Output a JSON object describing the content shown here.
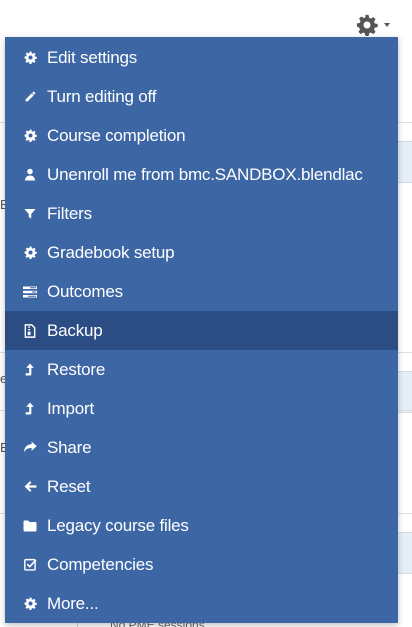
{
  "menu": {
    "items": [
      {
        "label": "Edit settings",
        "icon": "gear-icon"
      },
      {
        "label": "Turn editing off",
        "icon": "pencil-icon"
      },
      {
        "label": "Course completion",
        "icon": "gear-icon"
      },
      {
        "label": "Unenroll me from bmc.SANDBOX.blendlac",
        "icon": "user-icon"
      },
      {
        "label": "Filters",
        "icon": "filter-icon"
      },
      {
        "label": "Gradebook setup",
        "icon": "gear-icon"
      },
      {
        "label": "Outcomes",
        "icon": "outcomes-icon"
      },
      {
        "label": "Backup",
        "icon": "file-zip-icon",
        "highlighted": true
      },
      {
        "label": "Restore",
        "icon": "level-up-icon"
      },
      {
        "label": "Import",
        "icon": "level-up-icon"
      },
      {
        "label": "Share",
        "icon": "share-icon"
      },
      {
        "label": "Reset",
        "icon": "arrow-left-icon"
      },
      {
        "label": "Legacy course files",
        "icon": "folder-icon"
      },
      {
        "label": "Competencies",
        "icon": "checkbox-icon"
      },
      {
        "label": "More...",
        "icon": "gear-icon"
      }
    ]
  },
  "background": {
    "letters": [
      "E",
      "e",
      "E"
    ],
    "bottom_text": "No PME sessions"
  },
  "colors": {
    "menu_bg": "#3d66a4",
    "menu_active_bg": "#2b4d84",
    "menu_text": "#ffffff"
  }
}
